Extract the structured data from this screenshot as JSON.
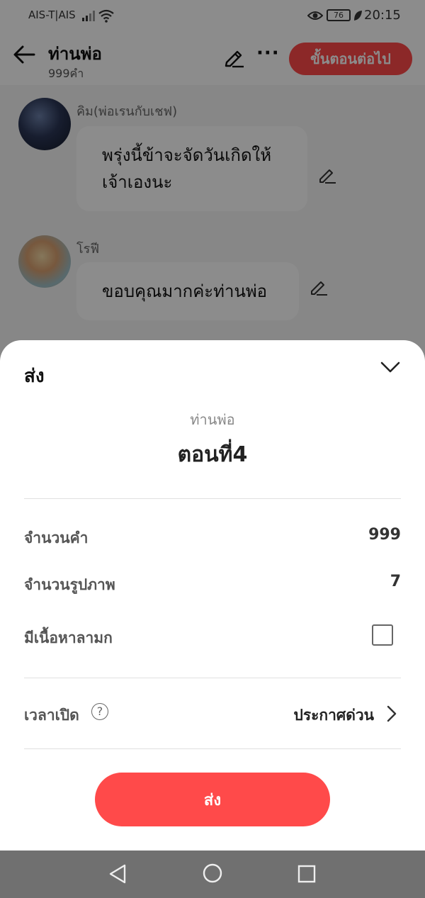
{
  "status_bar": {
    "carrier": "AIS-T|AIS",
    "battery": "76",
    "time": "20:15",
    "icons": [
      "signal-icon",
      "wifi-icon",
      "eye-icon",
      "battery-icon",
      "leaf-icon"
    ]
  },
  "header": {
    "title": "ท่านพ่อ",
    "word_count": "999คำ",
    "next_label": "ขั้นตอนต่อไป",
    "accent_color": "#ff4a4a"
  },
  "chat": {
    "messages": [
      {
        "speaker": "คิม(พ่อเรนกับเชฟ)",
        "lines": [
          "พรุ่งนี้ข้าจะจัดวันเกิดให้",
          "เจ้าเองนะ"
        ]
      },
      {
        "speaker": "โรฟี",
        "lines": [
          "ขอบคุณมากค่ะท่านพ่อ"
        ]
      }
    ]
  },
  "sheet": {
    "title": "ส่ง",
    "novel_name": "ท่านพ่อ",
    "episode": "ตอนที่4",
    "rows": {
      "word_count_label": "จำนวนคำ",
      "word_count_value": "999",
      "image_count_label": "จำนวนรูปภาพ",
      "image_count_value": "7",
      "explicit_label": "มีเนื้อหาลามก",
      "explicit_checked": false,
      "publish_time_label": "เวลาเปิด",
      "help_glyph": "?",
      "publish_time_value": "ประกาศด่วน"
    },
    "send_label": "ส่ง"
  }
}
